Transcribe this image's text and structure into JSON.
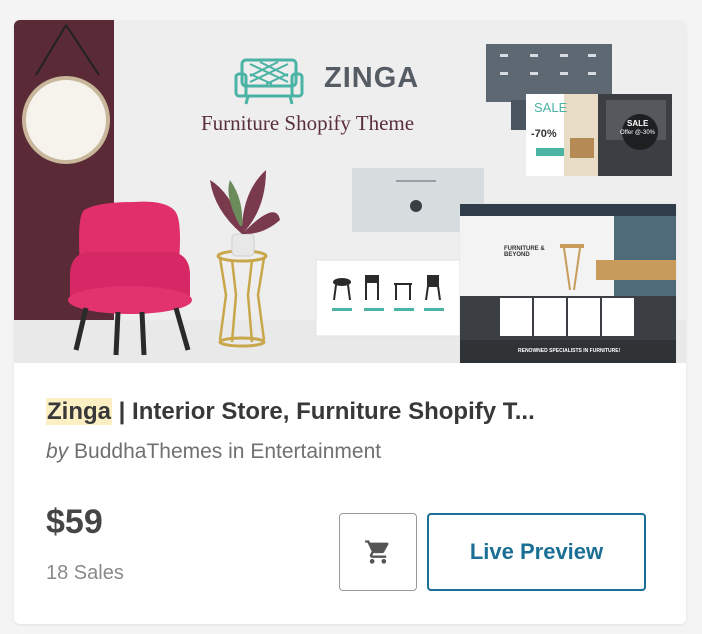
{
  "hero": {
    "logo_text": "ZINGA",
    "subtitle": "Furniture Shopify Theme",
    "sale_text": "SALE",
    "sale_percent": "-70%",
    "sale_badge": "SALE",
    "sale_offer": "Offer @-30%",
    "furniture_heading": "FURNITURE & BEYOND",
    "banner_text": "RENOWNED SPECIALISTS IN FURNITURE!"
  },
  "product": {
    "title_highlight": "Zinga",
    "title_rest": " | Interior Store, Furniture Shopify T...",
    "by_label": "by",
    "author": "BuddhaThemes",
    "in_label": "in",
    "category": "Entertainment",
    "price": "$59",
    "sales": "18 Sales"
  },
  "actions": {
    "preview_label": "Live Preview"
  },
  "icons": {
    "cart": "shopping-cart-icon"
  },
  "colors": {
    "accent": "#1b6f95",
    "chair": "#e02f6b",
    "wall": "#5a2a36"
  }
}
